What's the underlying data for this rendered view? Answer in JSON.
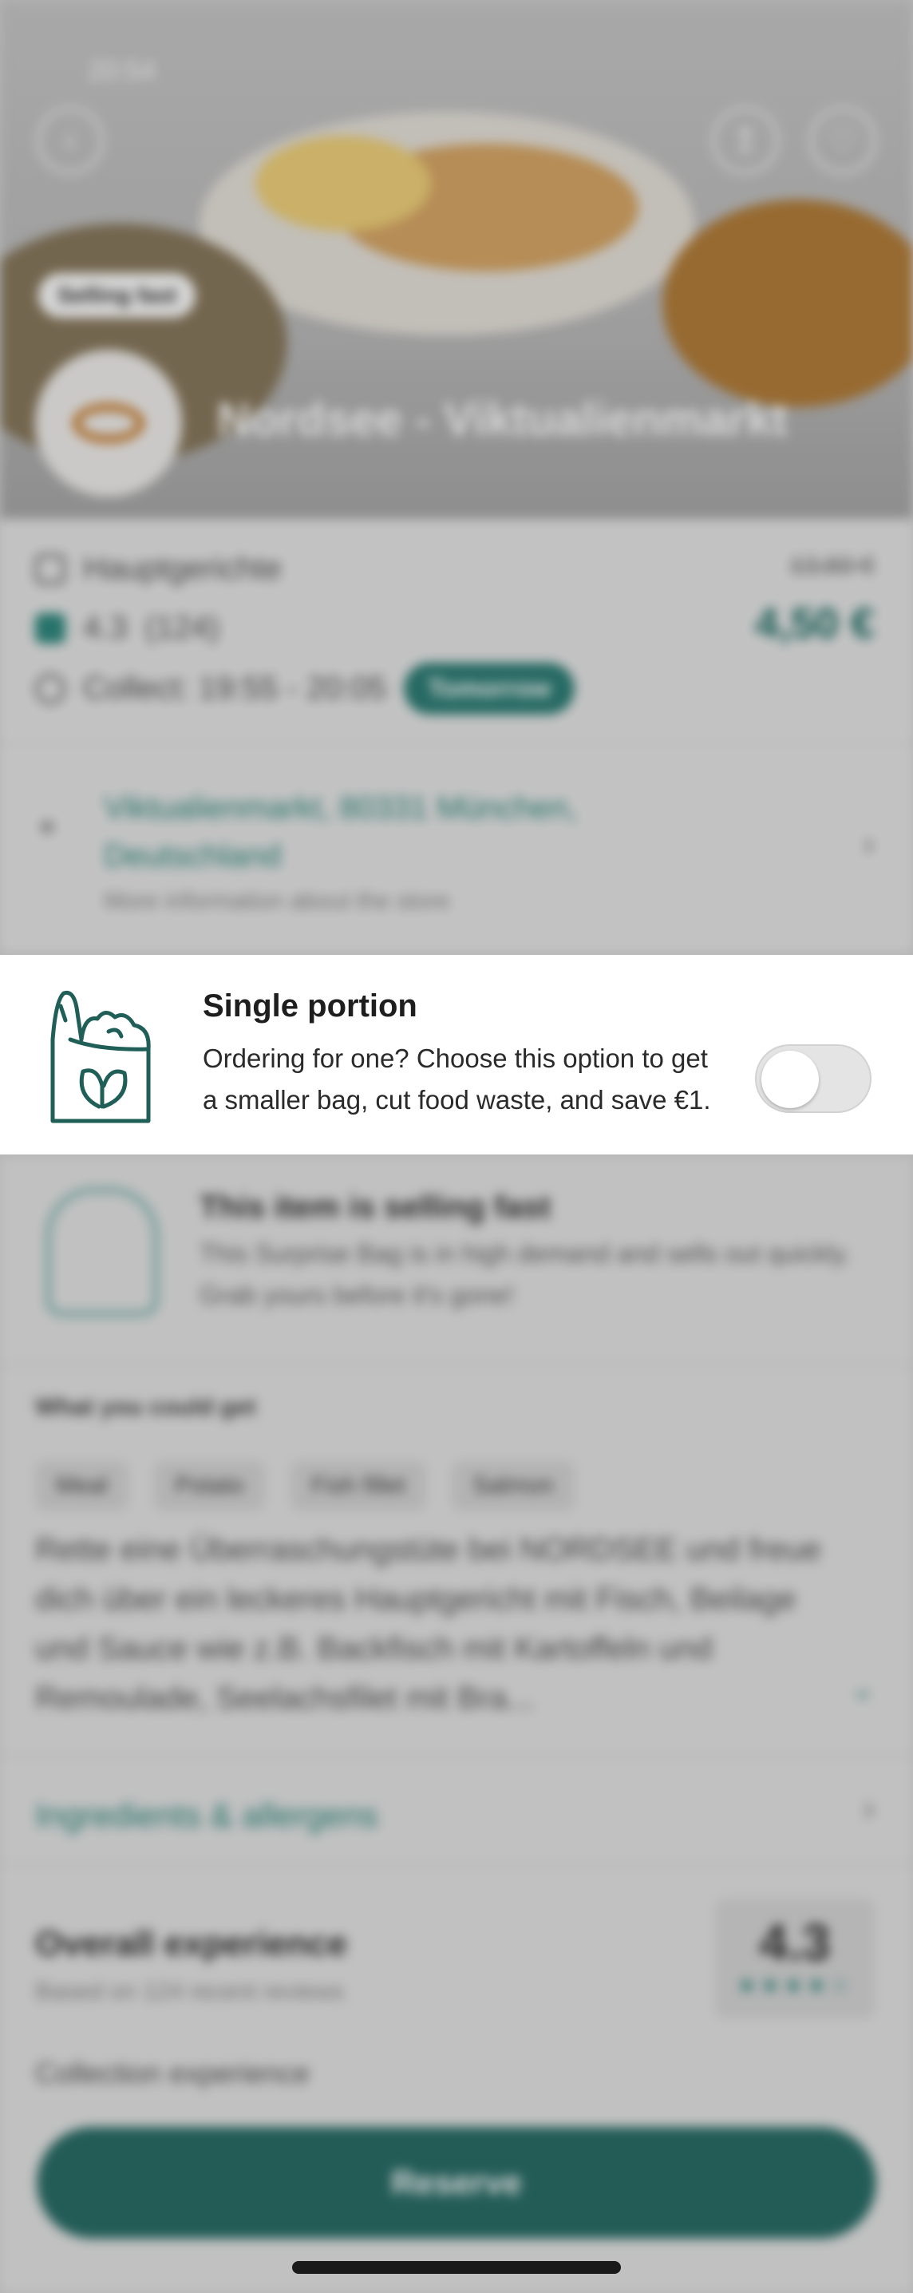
{
  "status_bar": {
    "time": "20:54"
  },
  "hero": {
    "badge": "Selling fast",
    "store_name": "Nordsee - Viktualienmarkt",
    "back_icon": "arrow-left-icon",
    "share_icon": "share-icon",
    "favorite_icon": "heart-icon"
  },
  "info": {
    "category": "Hauptgerichte",
    "rating": "4.3",
    "rating_count": "(124)",
    "collect": "Collect: 19:55 - 20:05",
    "collect_day": "Tomorrow",
    "old_price": "13,60 €",
    "price": "4,50 €"
  },
  "address": {
    "line": "Viktualienmarkt, 80331 München, Deutschland",
    "sub": "More information about the store"
  },
  "single_portion": {
    "title": "Single portion",
    "text": "Ordering for one? Choose this option to get a smaller bag, cut food waste, and save €1.",
    "toggle_on": false
  },
  "selling_fast": {
    "title": "This item is selling fast",
    "text": "This Surprise Bag is in high demand and sells out quickly. Grab yours before it's gone!"
  },
  "what_you_get": {
    "title": "What you could get",
    "chips": [
      "Meal",
      "Potato",
      "Fish fillet",
      "Salmon"
    ],
    "description": "Rette eine Überraschungstüte bei NORDSEE und freue dich über ein leckeres Hauptgericht mit Fisch, Beilage und Sauce wie z.B. Backfisch mit Kartoffeln und Remoulade, Seelachsfilet mit Bra..."
  },
  "ingredients_link": "Ingredients & allergens",
  "overall": {
    "title": "Overall experience",
    "sub": "Based on 124 recent reviews",
    "score": "4.3",
    "stars": "★★★★☆",
    "collection_label": "Collection experience"
  },
  "reserve_button": "Reserve",
  "colors": {
    "accent": "#2f8a80",
    "button": "#2a6e68"
  }
}
